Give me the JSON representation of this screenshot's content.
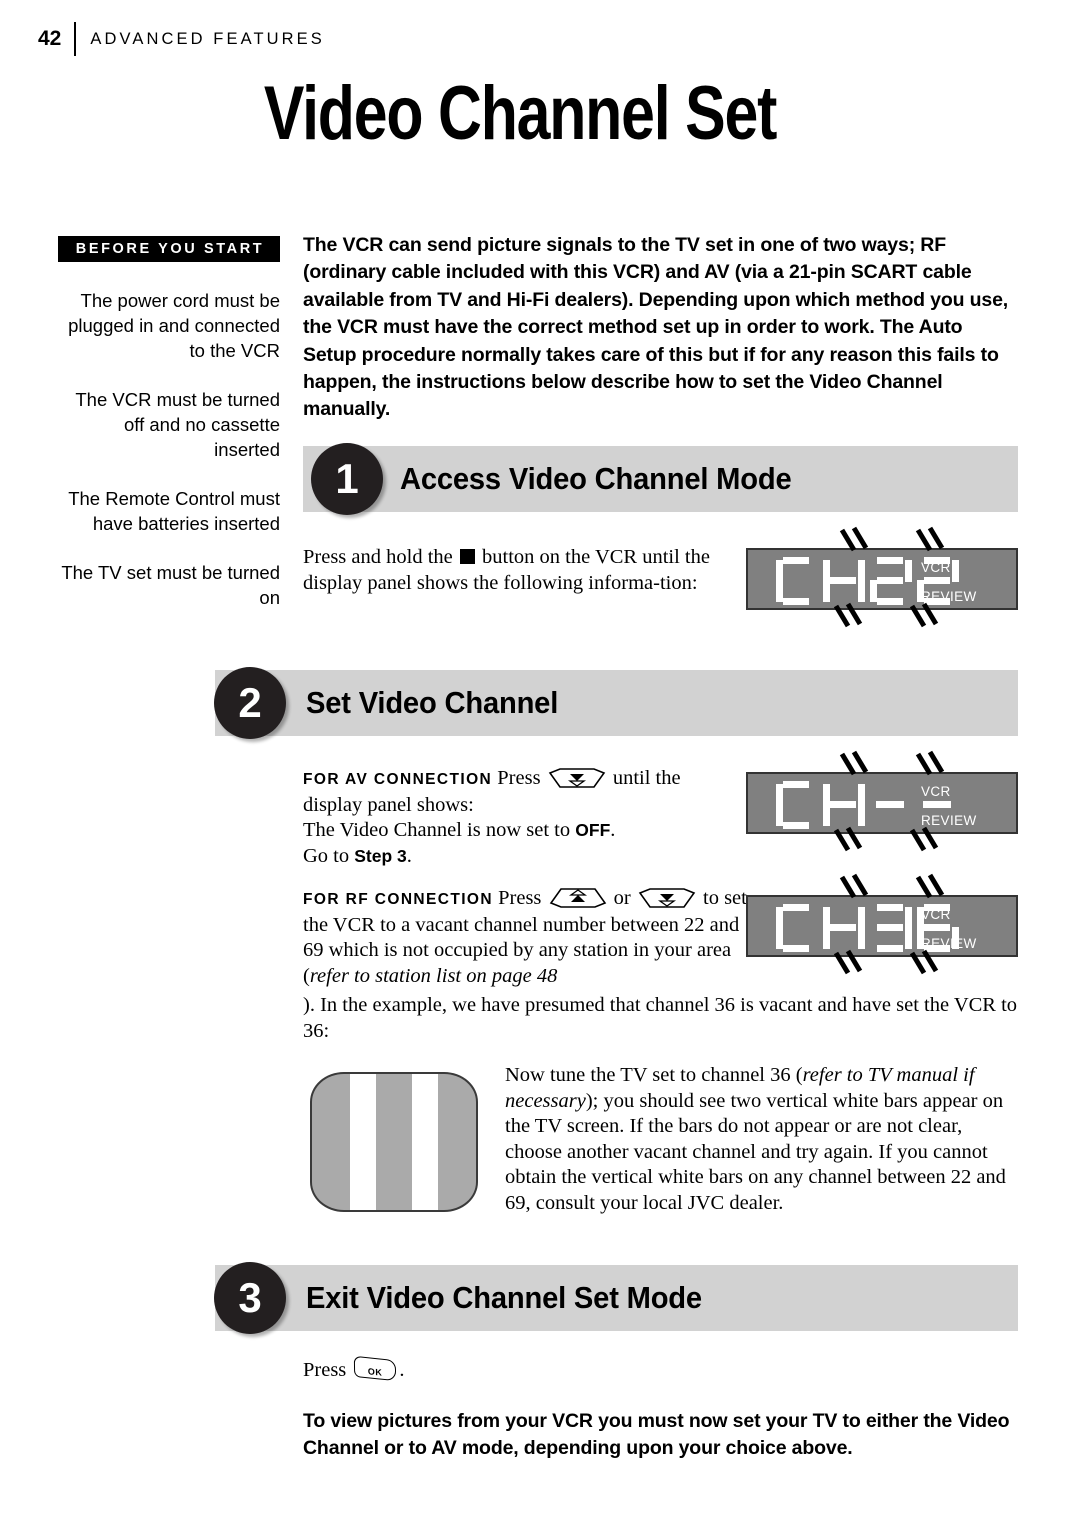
{
  "header": {
    "page_number": "42",
    "section": "ADVANCED FEATURES"
  },
  "title": "Video Channel Set",
  "sidebar": {
    "label": "BEFORE YOU START",
    "items": [
      "The power cord must be plugged in and connected to the VCR",
      "The VCR must be turned off and no cassette inserted",
      "The Remote Control must have batteries inserted",
      "The TV set must be turned on"
    ]
  },
  "intro": "The VCR can send picture signals to the TV set in one of two ways; RF (ordinary cable included with this VCR) and AV (via a 21-pin SCART cable available from TV and Hi-Fi dealers). Depending upon which method you use, the VCR must have the correct method set up in order to work. The Auto Setup procedure normally takes care of this but if for any reason this fails to happen, the instructions below describe how to set the Video Channel manually.",
  "steps": [
    {
      "number": "1",
      "title": "Access Video Channel Mode"
    },
    {
      "number": "2",
      "title": "Set Video Channel"
    },
    {
      "number": "3",
      "title": "Exit Video Channel Set Mode"
    }
  ],
  "step1": {
    "text_before_icon": "Press and hold the",
    "icon": "stop-button",
    "text_after_icon": "button on the VCR until the display panel shows the following informa-tion:"
  },
  "step2": {
    "av": {
      "lead": "FOR AV CONNECTION",
      "press": "Press",
      "key": "channel-down-key",
      "after_key": "until the display panel shows:",
      "line2_a": "The Video Channel is now set to ",
      "line2_bold": "OFF",
      "line2_b": ".",
      "line3_a": "Go to ",
      "line3_bold": "Step 3",
      "line3_b": "."
    },
    "rf": {
      "lead": "FOR RF CONNECTION",
      "press": "Press",
      "key_up": "channel-up-key",
      "or": "or",
      "key_down": "channel-down-key",
      "after": "to set the VCR to a vacant channel number between 22 and 69 which is not occupied by any station in your area (",
      "italic": "refer to station list on page 48",
      "after2": "). In the example, we have presumed that channel 36 is vacant and have set the VCR to 36:"
    },
    "tv_paragraph": {
      "a": "Now tune the TV set to channel 36 (",
      "italic": "refer to TV manual if necessary",
      "b": "); you should see two vertical white bars appear on the TV screen. If the bars do not appear or are not clear, choose another vacant channel and try again. If you cannot obtain the vertical white bars on any channel between 22 and 69, consult your local JVC dealer."
    }
  },
  "step3": {
    "press": "Press",
    "key": "ok-key",
    "key_label": "OK",
    "period": "."
  },
  "closing": "To view pictures from your VCR you must now set your TV to either the Video Channel or to AV mode, depending upon your choice above.",
  "displays": [
    {
      "id": "display-ch22",
      "text": "CH22",
      "chars": [
        "C",
        "H",
        "2",
        "2"
      ],
      "label_top": "VCR",
      "label_bottom": "REVIEW",
      "blinking": true
    },
    {
      "id": "display-ch-off",
      "text": "CH--",
      "chars": [
        "C",
        "H",
        "-",
        "-"
      ],
      "label_top": "VCR",
      "label_bottom": "REVIEW",
      "blinking": true
    },
    {
      "id": "display-ch36",
      "text": "CH36",
      "chars": [
        "C",
        "H",
        "3",
        "6"
      ],
      "label_top": "VCR",
      "label_bottom": "REVIEW",
      "blinking": true
    }
  ],
  "colors": {
    "step_bar": "#d2d2d2",
    "badge": "#231f20",
    "display_panel": "#808080",
    "tv_screen": "#aaaaaa"
  }
}
